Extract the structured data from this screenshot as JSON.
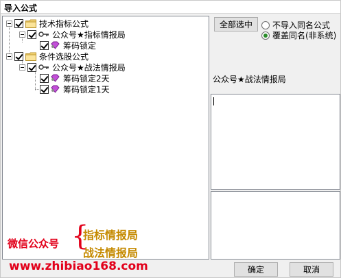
{
  "window": {
    "title": "导入公式"
  },
  "tree": {
    "groups": [
      {
        "label": "技术指标公式",
        "children": [
          {
            "label": "公众号★指标情报局",
            "items": [
              "筹码锁定"
            ]
          }
        ]
      },
      {
        "label": "条件选股公式",
        "children": [
          {
            "label": "公众号★战法情报局",
            "items": [
              "筹码锁定2天",
              "筹码锁定1天"
            ]
          }
        ]
      }
    ]
  },
  "promo": {
    "left": "微信公众号",
    "brace": "{",
    "right1": "指标情报局",
    "right2": "战法情报局",
    "url": "www.zhibiao168.com"
  },
  "actions": {
    "select_all": "全部选中",
    "ok": "确定",
    "cancel": "取消"
  },
  "options": {
    "skip_same": "不导入同名公式",
    "overwrite_same": "覆盖同名(非系统)",
    "selected": "overwrite_same"
  },
  "detail": {
    "name": "公众号★战法情报局"
  },
  "colors": {
    "promo_red": "#e2001a",
    "promo_gold": "#c58a00",
    "radio_selected": "#2a8c2a"
  }
}
